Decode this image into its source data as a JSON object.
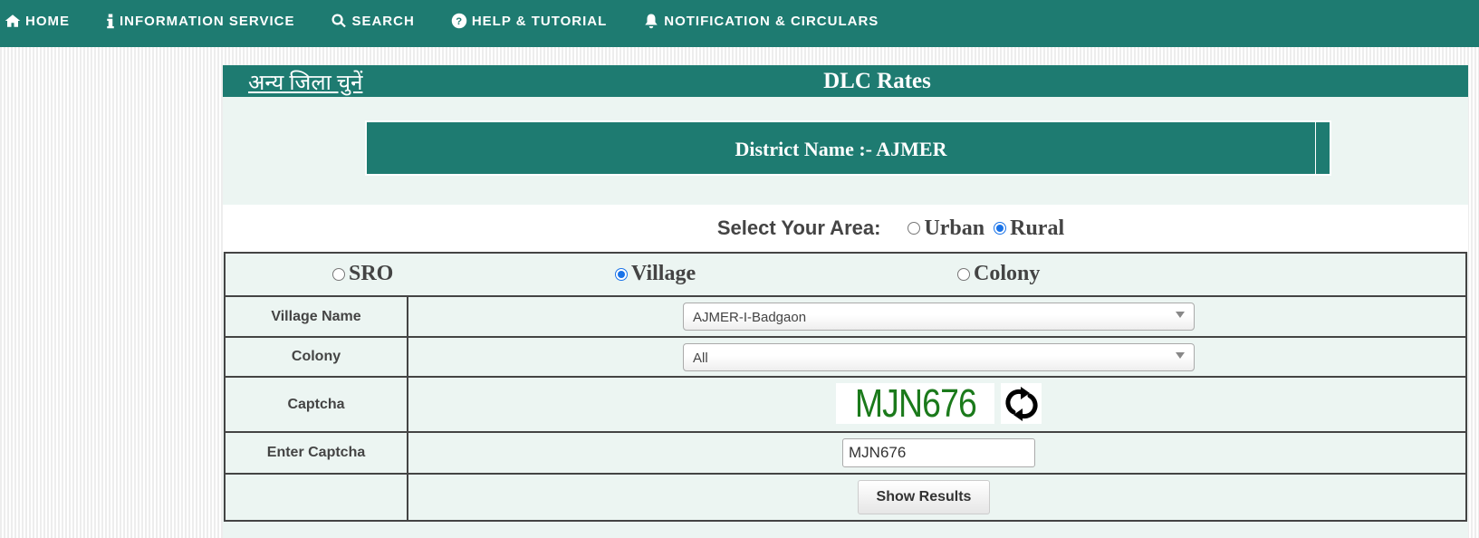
{
  "nav": {
    "items": [
      {
        "label": "HOME",
        "icon": "home-icon"
      },
      {
        "label": "INFORMATION SERVICE",
        "icon": "info-icon"
      },
      {
        "label": "SEARCH",
        "icon": "search-icon"
      },
      {
        "label": "HELP & TUTORIAL",
        "icon": "question-circle-icon"
      },
      {
        "label": "NOTIFICATION & CIRCULARS",
        "icon": "bell-icon"
      }
    ]
  },
  "header": {
    "other_district_link": "अन्य जिला चुनें",
    "title": "DLC Rates"
  },
  "district": {
    "label": "District Name :- AJMER"
  },
  "area": {
    "label": "Select Your Area:",
    "options": [
      {
        "label": "Urban",
        "checked": false
      },
      {
        "label": "Rural",
        "checked": true
      }
    ]
  },
  "search_type": {
    "options": [
      {
        "label": "SRO",
        "checked": false
      },
      {
        "label": "Village",
        "checked": true
      },
      {
        "label": "Colony",
        "checked": false
      }
    ]
  },
  "form": {
    "village_label": "Village Name",
    "village_value": "AJMER-I-Badgaon",
    "colony_label": "Colony",
    "colony_value": "All",
    "captcha_label": "Captcha",
    "captcha_text": "MJN676",
    "enter_captcha_label": "Enter Captcha",
    "enter_captcha_value": "MJN676",
    "submit_label": "Show Results"
  },
  "colors": {
    "brand": "#1e7b71",
    "panel_bg": "#ecf5f2",
    "captcha_text": "#1b7a1b",
    "radio_checked": "#1a73e8"
  }
}
